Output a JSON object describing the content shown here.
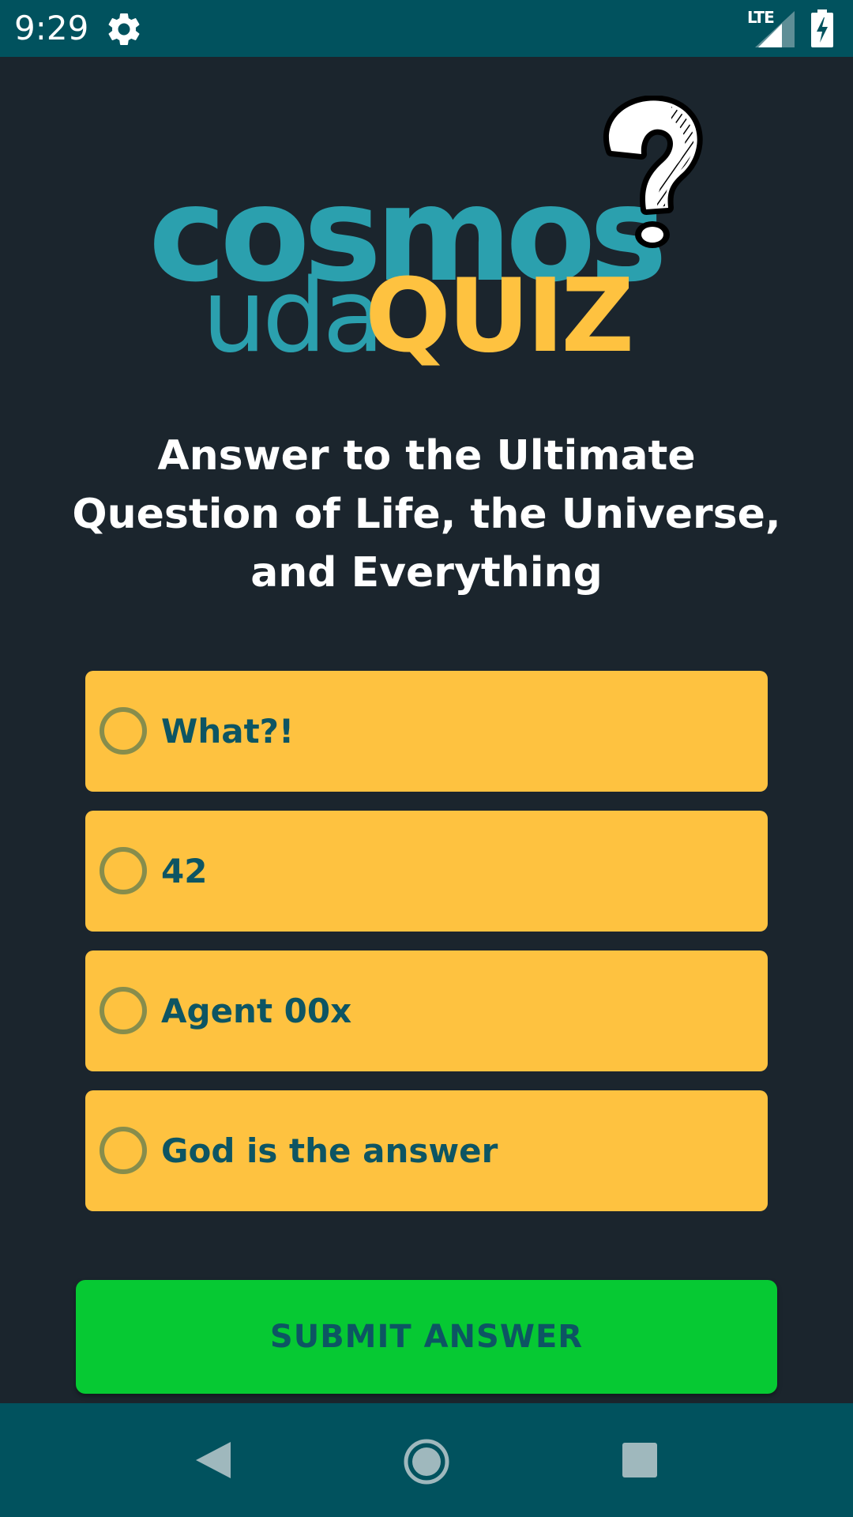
{
  "status_bar": {
    "time": "9:29",
    "network": "LTE",
    "icons": [
      "settings-gear-icon",
      "cell-signal-icon",
      "battery-charging-icon"
    ]
  },
  "logo": {
    "line1": "cosmos",
    "line2_prefix": "uda",
    "line2_highlight": "QUIZ",
    "decoration": "question-mark-icon"
  },
  "question": {
    "text": "Answer to the Ultimate Question of Life, the Universe, and Everything"
  },
  "options": [
    {
      "label": "What?!",
      "selected": false
    },
    {
      "label": "42",
      "selected": false
    },
    {
      "label": "Agent 00x",
      "selected": false
    },
    {
      "label": "God is the answer",
      "selected": false
    }
  ],
  "submit": {
    "label": "SUBMIT ANSWER"
  },
  "nav_bar": {
    "icons": [
      "back-icon",
      "home-icon",
      "recent-apps-icon"
    ]
  },
  "colors": {
    "background": "#1B252D",
    "bar": "#01525E",
    "brand_teal": "#2BA0AE",
    "brand_yellow": "#FEC240",
    "option_text": "#0D5563",
    "radio_ring": "#878D4C",
    "submit_green": "#06C933"
  }
}
